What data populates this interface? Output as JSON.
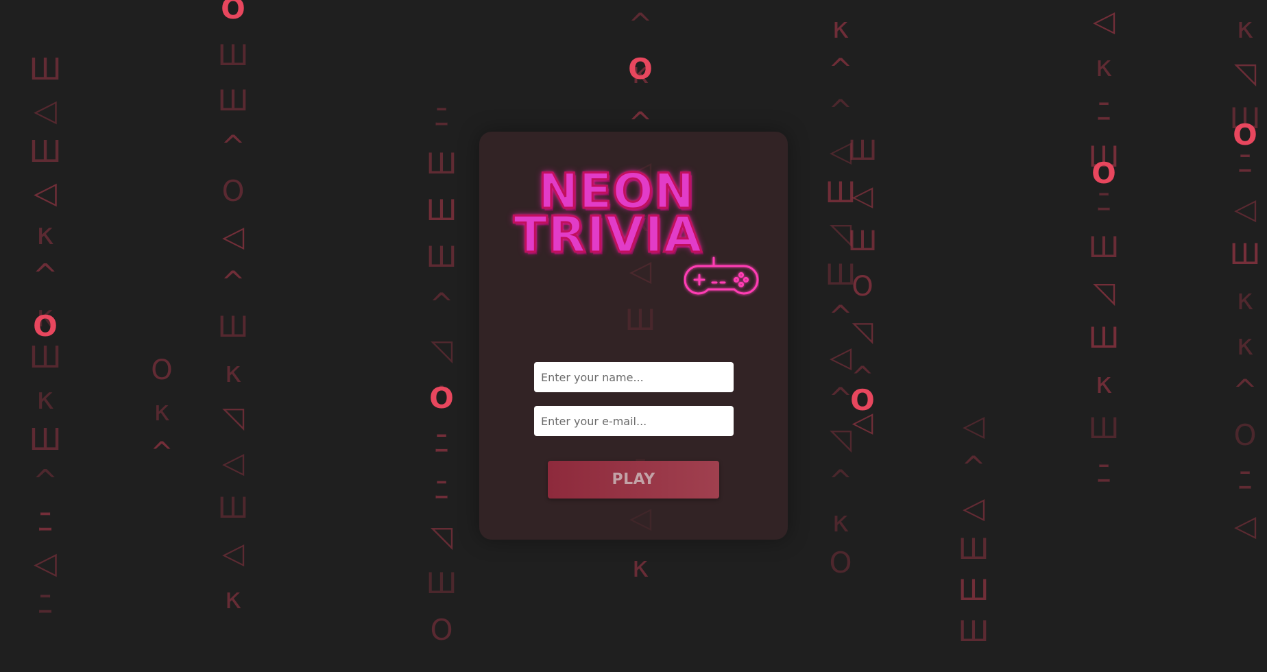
{
  "app": {
    "logo_line1": "NEON",
    "logo_line2": "TRIVIA",
    "logo_icon": "gamepad-icon"
  },
  "form": {
    "name_placeholder": "Enter your name...",
    "name_value": "",
    "email_placeholder": "Enter your e-mail...",
    "email_value": "",
    "play_label": "PLAY"
  },
  "background": {
    "description_icon": "falling-glyph-rain",
    "glyph_set": [
      "◁",
      "^",
      "O",
      "Ш",
      "κ",
      "◹",
      "ﾆ"
    ],
    "colors": {
      "page": "#1f1f1f",
      "glyph": "#be3c50",
      "glyph_bright": "#e8475e",
      "card": "#3a2628",
      "logo_fill": "#e23cc8",
      "logo_glow": "#ff2fb0",
      "button": "#8e2a3c"
    }
  }
}
